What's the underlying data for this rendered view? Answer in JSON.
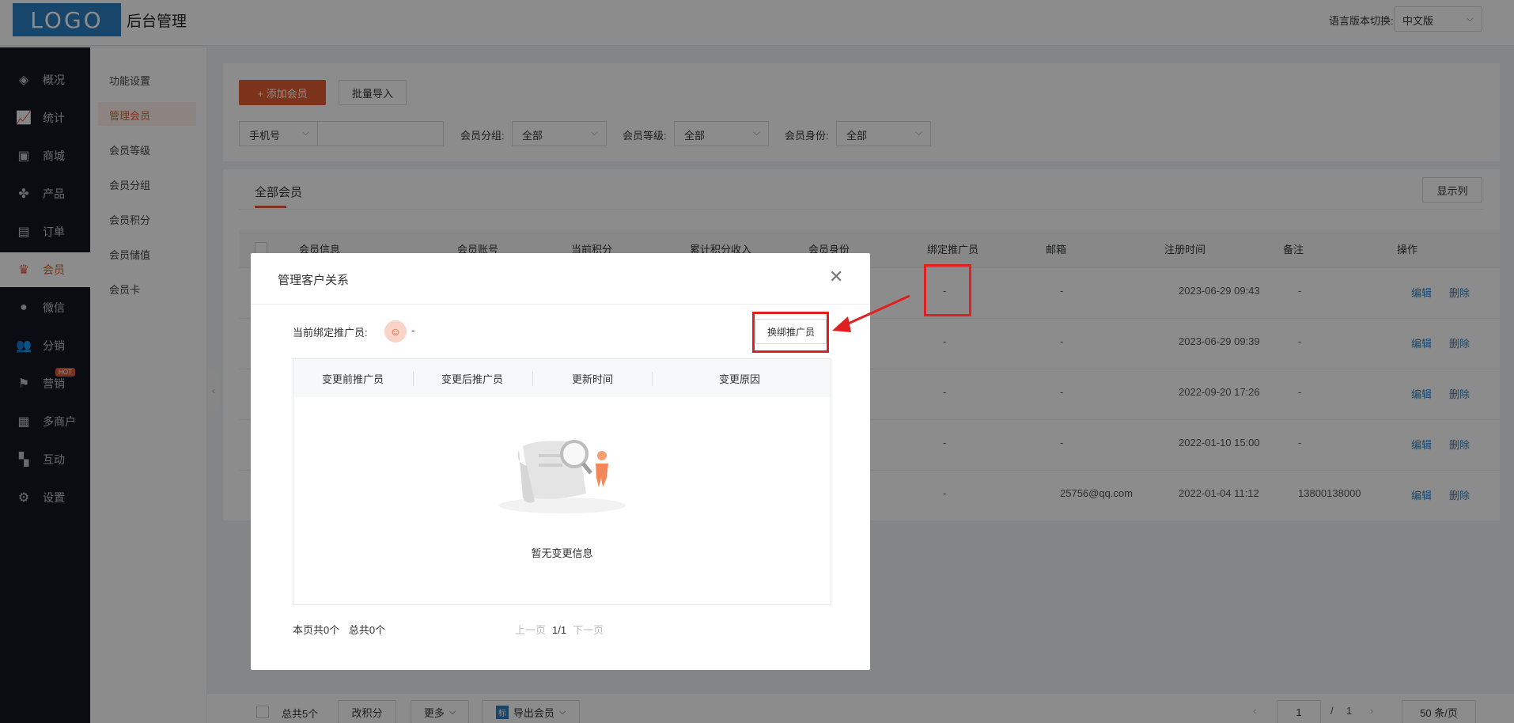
{
  "header": {
    "logo": "LOGO",
    "title": "后台管理",
    "lang_label": "语言版本切换:",
    "lang_value": "中文版"
  },
  "sidebar": {
    "items": [
      {
        "label": "概况",
        "icon": "layers-icon"
      },
      {
        "label": "统计",
        "icon": "chart-icon"
      },
      {
        "label": "商城",
        "icon": "store-icon"
      },
      {
        "label": "产品",
        "icon": "grid-icon"
      },
      {
        "label": "订单",
        "icon": "clipboard-icon"
      },
      {
        "label": "会员",
        "icon": "crown-icon",
        "active": true
      },
      {
        "label": "微信",
        "icon": "wechat-icon"
      },
      {
        "label": "分销",
        "icon": "users-icon"
      },
      {
        "label": "营销",
        "icon": "flag-icon",
        "badge": "HOT"
      },
      {
        "label": "多商户",
        "icon": "shop-icon"
      },
      {
        "label": "互动",
        "icon": "apps-icon"
      },
      {
        "label": "设置",
        "icon": "gear-icon"
      }
    ]
  },
  "subnav": {
    "items": [
      "功能设置",
      "管理会员",
      "会员等级",
      "会员分组",
      "会员积分",
      "会员储值",
      "会员卡"
    ],
    "active_index": 1
  },
  "filters": {
    "add_label": "+ 添加会员",
    "import_label": "批量导入",
    "search_type": "手机号",
    "search_value": "",
    "group_label": "会员分组:",
    "group_value": "全部",
    "level_label": "会员等级:",
    "level_value": "全部",
    "identity_label": "会员身份:",
    "identity_value": "全部"
  },
  "table": {
    "tab": "全部会员",
    "columns_button": "显示列",
    "headers": [
      "会员信息",
      "会员账号",
      "当前积分",
      "累计积分收入",
      "会员身份",
      "绑定推广员",
      "邮箱",
      "注册时间",
      "备注",
      "操作"
    ],
    "rows": [
      {
        "promoter": "-",
        "email": "-",
        "registered": "2023-06-29 09:43",
        "note": "-"
      },
      {
        "promoter": "-",
        "email": "-",
        "registered": "2023-06-29 09:39",
        "note": "-"
      },
      {
        "promoter": "-",
        "email": "-",
        "registered": "2022-09-20 17:26",
        "note": "-"
      },
      {
        "promoter": "-",
        "email": "-",
        "registered": "2022-01-10 15:00",
        "note": "-"
      },
      {
        "promoter": "-",
        "email": "25756@qq.com",
        "registered": "2022-01-04 11:12",
        "note": "13800138000"
      }
    ],
    "edit_label": "编辑",
    "delete_label": "删除"
  },
  "bottom_bar": {
    "total": "总共5个",
    "change_points": "改积分",
    "more": "更多",
    "export": "导出会员",
    "export_badge": "标",
    "page_current": "1",
    "page_sep": "/",
    "page_total": "1",
    "page_size": "50 条/页"
  },
  "modal": {
    "title": "管理客户关系",
    "current_label": "当前绑定推广员:",
    "current_value": "-",
    "rebind_label": "换绑推广员",
    "headers": [
      "变更前推广员",
      "变更后推广员",
      "更新时间",
      "变更原因"
    ],
    "empty_text": "暂无变更信息",
    "page_count": "本页共0个",
    "total_count": "总共0个",
    "prev": "上一页",
    "page": "1/1",
    "next": "下一页"
  },
  "colors": {
    "accent": "#e35b33",
    "link": "#2d7fc1",
    "highlight": "#e02020"
  }
}
